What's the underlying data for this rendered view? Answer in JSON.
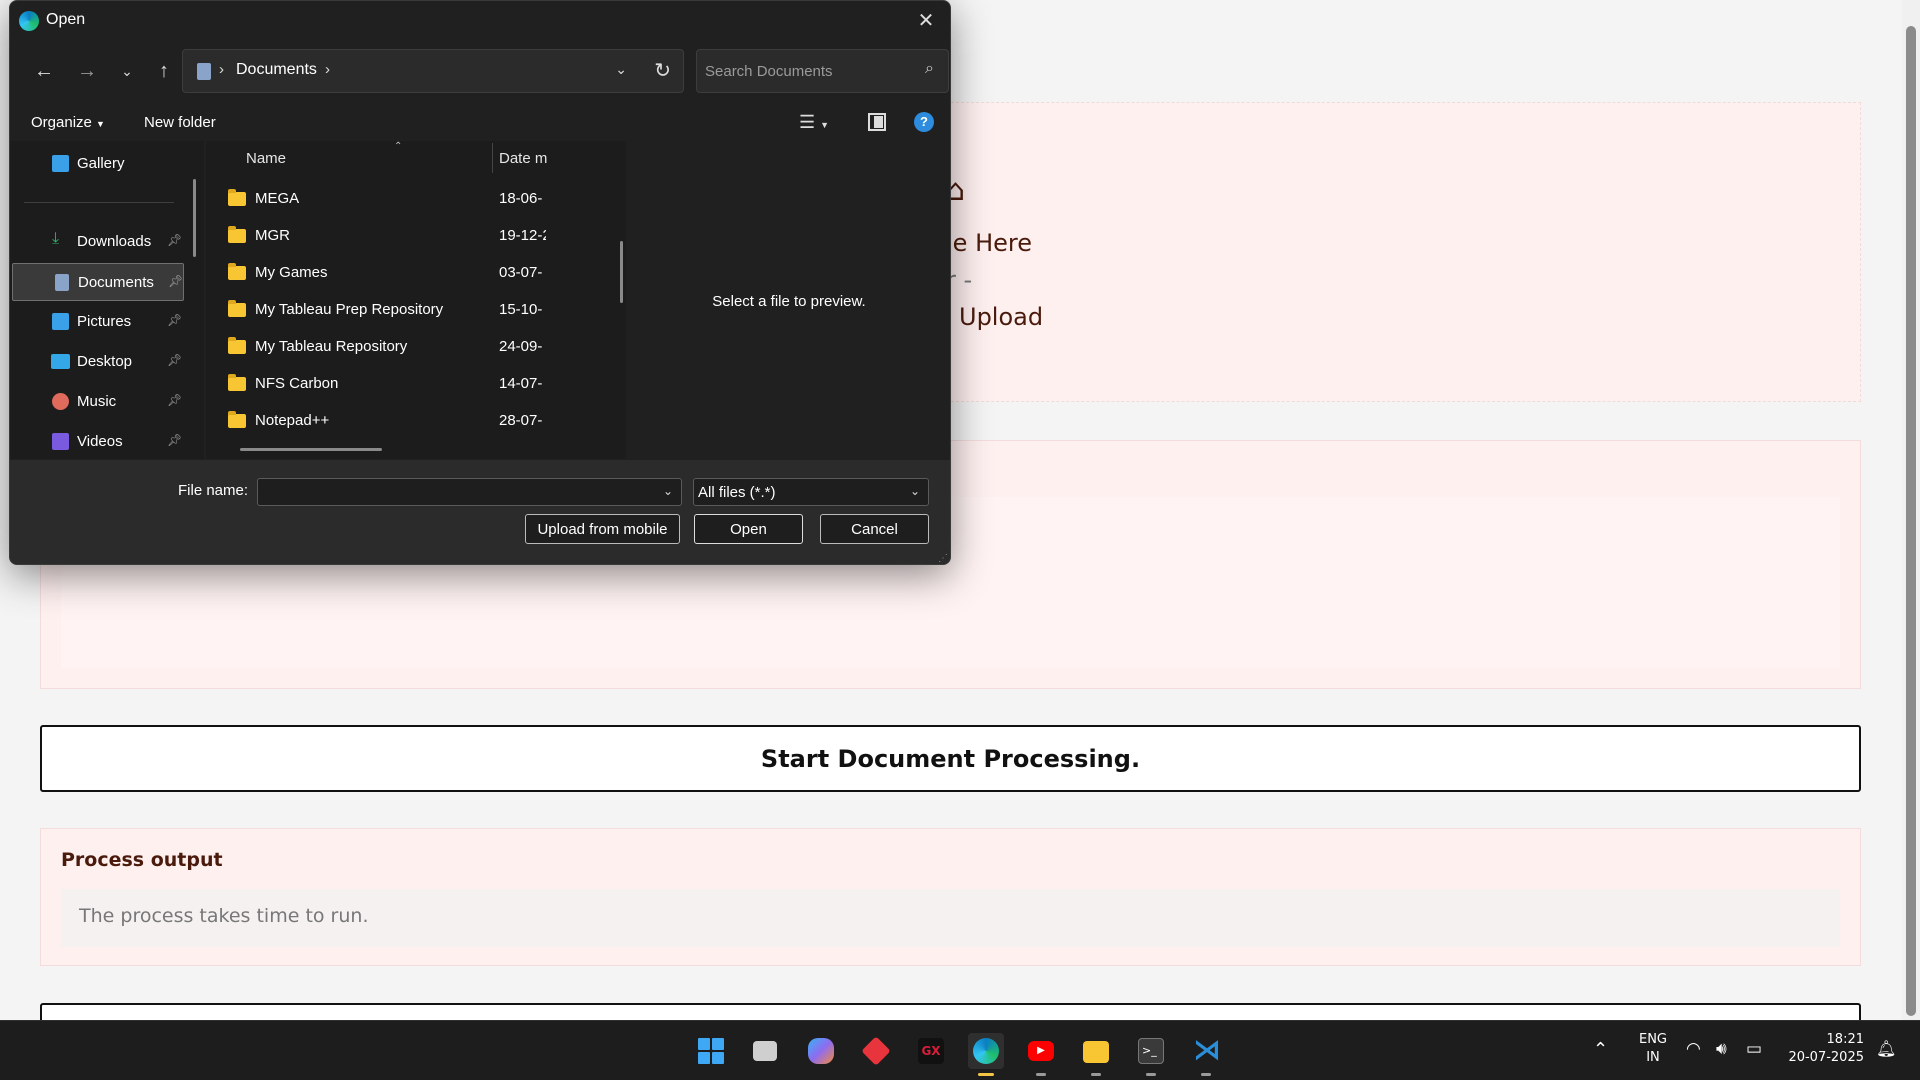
{
  "page": {
    "upload_zone": {
      "line1": "le Here",
      "line2": "r -",
      "line3": "Upload",
      "arrow_icon": "upload-arrow-icon"
    },
    "start_button_label": "Start Document Processing.",
    "output": {
      "title": "Process output",
      "text": "The process takes time to run."
    }
  },
  "dialog": {
    "title": "Open",
    "address": {
      "crumb": "Documents",
      "separator": "›"
    },
    "search_placeholder": "Search Documents",
    "command_bar": {
      "organize": "Organize",
      "new_folder": "New folder"
    },
    "nav_pane": [
      {
        "label": "Gallery",
        "icon": "gallery-icon",
        "pinned": false,
        "color": "#3aa0e8"
      },
      {
        "label": "Downloads",
        "icon": "download-icon",
        "pinned": true,
        "color": "#2fb36a"
      },
      {
        "label": "Documents",
        "icon": "documents-icon",
        "pinned": true,
        "color": "#8aa3c8",
        "selected": true
      },
      {
        "label": "Pictures",
        "icon": "pictures-icon",
        "pinned": true,
        "color": "#3aa0e8"
      },
      {
        "label": "Desktop",
        "icon": "desktop-icon",
        "pinned": true,
        "color": "#34a7e6"
      },
      {
        "label": "Music",
        "icon": "music-icon",
        "pinned": true,
        "color": "#e06a5c"
      },
      {
        "label": "Videos",
        "icon": "videos-icon",
        "pinned": true,
        "color": "#7a5be0"
      }
    ],
    "columns": {
      "name": "Name",
      "date": "Date m"
    },
    "files": [
      {
        "name": "MEGA",
        "date": "18-06-"
      },
      {
        "name": "MGR",
        "date": "19-12-2"
      },
      {
        "name": "My Games",
        "date": "03-07-"
      },
      {
        "name": "My Tableau Prep Repository",
        "date": "15-10-"
      },
      {
        "name": "My Tableau Repository",
        "date": "24-09-"
      },
      {
        "name": "NFS Carbon",
        "date": "14-07-"
      },
      {
        "name": "Notepad++",
        "date": "28-07-"
      }
    ],
    "preview_message": "Select a file to preview.",
    "file_name_label": "File name:",
    "file_name_value": "",
    "file_type": "All files (*.*)",
    "buttons": {
      "upload_mobile": "Upload from mobile",
      "open": "Open",
      "cancel": "Cancel"
    }
  },
  "taskbar": {
    "apps": [
      {
        "name": "start",
        "icon": "windows-start-icon",
        "color": "#3fa8f4"
      },
      {
        "name": "task-view",
        "icon": "task-view-icon",
        "color": "#cfcfcf"
      },
      {
        "name": "copilot",
        "icon": "copilot-icon",
        "color": "#8e6cf0"
      },
      {
        "name": "app-red",
        "icon": "red-diamond-app-icon",
        "color": "#e8343c"
      },
      {
        "name": "opera-gx",
        "icon": "opera-gx-icon",
        "color": "#d81e3a"
      },
      {
        "name": "edge",
        "icon": "edge-icon",
        "color": "#1fa1d8"
      },
      {
        "name": "youtube",
        "icon": "youtube-icon",
        "color": "#ff0000"
      },
      {
        "name": "file-explorer",
        "icon": "folder-icon",
        "color": "#f8c533"
      },
      {
        "name": "terminal",
        "icon": "terminal-icon",
        "color": "#4a4a4a"
      },
      {
        "name": "vscode",
        "icon": "vscode-icon",
        "color": "#2a8fd8"
      }
    ],
    "lang_line1": "ENG",
    "lang_line2": "IN",
    "time": "18:21",
    "date": "20-07-2025"
  }
}
